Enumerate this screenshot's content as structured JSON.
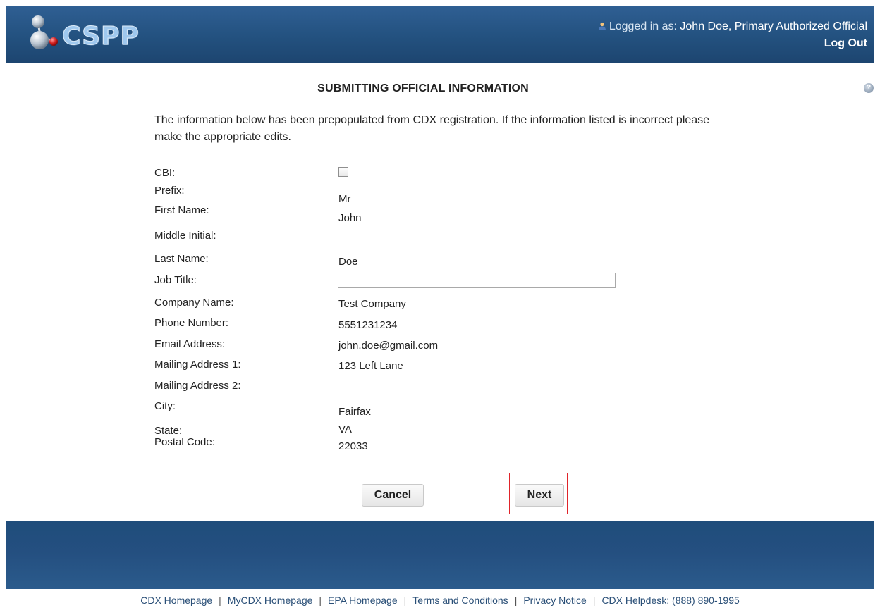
{
  "header": {
    "logo_text": "CSPP",
    "logged_in_prefix": "Logged in as:",
    "user_name": "John Doe, Primary Authorized Official",
    "logout_label": "Log Out"
  },
  "page": {
    "title": "SUBMITTING OFFICIAL INFORMATION",
    "intro": "The information below has been prepopulated from CDX registration. If the information listed is incorrect please make the appropriate edits.",
    "help_icon_glyph": "?"
  },
  "form": {
    "cbi_label": "CBI:",
    "cbi_checked": false,
    "prefix_label": "Prefix:",
    "prefix_value": "Mr",
    "first_name_label": "First Name:",
    "first_name_value": "John",
    "middle_initial_label": "Middle Initial:",
    "middle_initial_value": "",
    "last_name_label": "Last Name:",
    "last_name_value": "Doe",
    "job_title_label": "Job Title:",
    "job_title_value": "",
    "company_label": "Company Name:",
    "company_value": "Test Company",
    "phone_label": "Phone Number:",
    "phone_value": "5551231234",
    "email_label": "Email Address:",
    "email_value": "john.doe@gmail.com",
    "mail1_label": "Mailing Address 1:",
    "mail1_value": "123 Left Lane",
    "mail2_label": "Mailing Address 2:",
    "mail2_value": "",
    "city_label": "City:",
    "city_value": "Fairfax",
    "state_label": "State:",
    "state_value": "VA",
    "postal_label": "Postal Code:",
    "postal_value": "22033"
  },
  "buttons": {
    "cancel_label": "Cancel",
    "next_label": "Next"
  },
  "footer": {
    "links": [
      "CDX Homepage",
      "MyCDX Homepage",
      "EPA Homepage",
      "Terms and Conditions",
      "Privacy Notice",
      "CDX Helpdesk: (888) 890-1995"
    ],
    "separator": "|"
  },
  "colors": {
    "header_bg": "#23517f",
    "highlight_border": "#e0242a",
    "footer_link": "#2a4f77"
  }
}
